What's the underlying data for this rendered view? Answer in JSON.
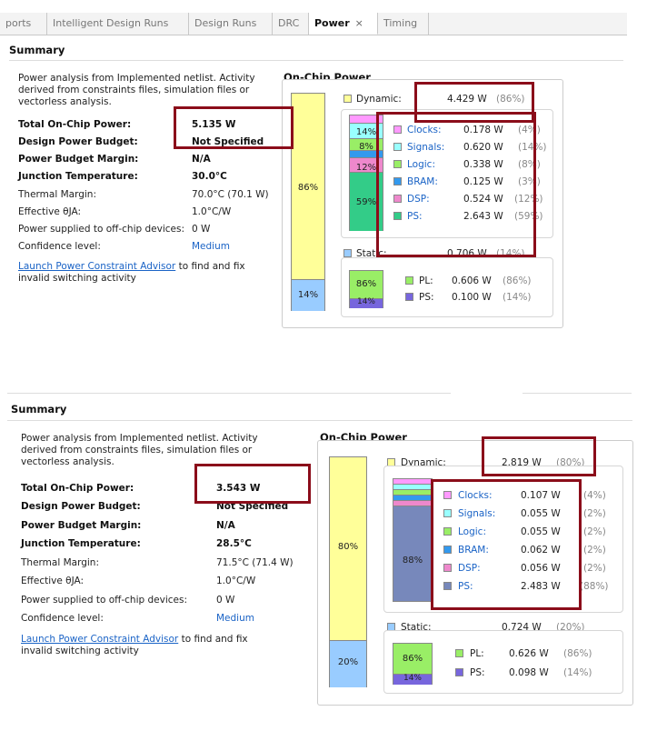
{
  "tabs": [
    "ports",
    "Intelligent Design Runs",
    "Design Runs",
    "DRC",
    "Power",
    "Timing"
  ],
  "tab_close_glyph": "×",
  "shared": {
    "summary_title": "Summary",
    "description": "Power analysis from Implemented netlist. Activity derived from constraints files, simulation files or vectorless analysis.",
    "on_chip_title": "On-Chip Power",
    "labels": {
      "total": "Total On-Chip Power:",
      "budget": "Design Power Budget:",
      "margin": "Power Budget Margin:",
      "junction": "Junction Temperature:",
      "thermal": "Thermal Margin:",
      "effective": "Effective θJA:",
      "offchip": "Power supplied to off-chip devices:",
      "confidence": "Confidence level:"
    },
    "link_text": "Launch Power Constraint Advisor",
    "link_suffix": " to find and fix",
    "link_suffix2": "invalid switching activity",
    "dynamic_label": "Dynamic:",
    "static_label": "Static:",
    "rows": [
      "Clocks:",
      "Signals:",
      "Logic:",
      "BRAM:",
      "DSP:",
      "PS:"
    ],
    "static_rows": [
      "PL:",
      "PS:"
    ]
  },
  "colors": {
    "yellow": "#ffff99",
    "lightblue": "#99ccff",
    "clocks": "#ff99ff",
    "signals": "#99ffff",
    "logic": "#99ee66",
    "bram": "#3399ee",
    "dsp": "#ee88cc",
    "ps_top": "#33cc88",
    "ps_bottom": "#7788bb",
    "pl": "#99ee66",
    "ps_static": "#7766dd",
    "accent": "#8b0d1a"
  },
  "top": {
    "values": {
      "total": "5.135 W",
      "budget": "Not Specified",
      "margin": "N/A",
      "junction": "30.0°C",
      "thermal": "70.0°C (70.1 W)",
      "effective": "1.0°C/W",
      "offchip": "0 W",
      "confidence": "Medium"
    },
    "bar": {
      "dynamic_pct": "86%",
      "static_pct": "14%"
    },
    "dynamic": {
      "value": "4.429 W",
      "pct": "(86%)"
    },
    "rows": [
      {
        "value": "0.178 W",
        "pct": "(4%)"
      },
      {
        "value": "0.620 W",
        "pct": "(14%)"
      },
      {
        "value": "0.338 W",
        "pct": "(8%)"
      },
      {
        "value": "0.125 W",
        "pct": "(3%)"
      },
      {
        "value": "0.524 W",
        "pct": "(12%)"
      },
      {
        "value": "2.643 W",
        "pct": "(59%)"
      }
    ],
    "dyn_bar_labels": [
      "14%",
      "8%",
      "12%",
      "59%"
    ],
    "static": {
      "value": "0.706 W",
      "pct": "(14%)"
    },
    "static_rows": [
      {
        "value": "0.606 W",
        "pct": "(86%)"
      },
      {
        "value": "0.100 W",
        "pct": "(14%)"
      }
    ],
    "static_bar_labels": [
      "86%",
      "14%"
    ]
  },
  "bottom": {
    "values": {
      "total": "3.543 W",
      "budget": "Not Specified",
      "margin": "N/A",
      "junction": "28.5°C",
      "thermal": "71.5°C (71.4 W)",
      "effective": "1.0°C/W",
      "offchip": "0 W",
      "confidence": "Medium"
    },
    "bar": {
      "dynamic_pct": "80%",
      "static_pct": "20%"
    },
    "dynamic": {
      "value": "2.819 W",
      "pct": "(80%)"
    },
    "rows": [
      {
        "value": "0.107 W",
        "pct": "(4%)"
      },
      {
        "value": "0.055 W",
        "pct": "(2%)"
      },
      {
        "value": "0.055 W",
        "pct": "(2%)"
      },
      {
        "value": "0.062 W",
        "pct": "(2%)"
      },
      {
        "value": "0.056 W",
        "pct": "(2%)"
      },
      {
        "value": "2.483 W",
        "pct": "(88%)"
      }
    ],
    "dyn_bar_labels": [
      "88%"
    ],
    "static": {
      "value": "0.724 W",
      "pct": "(20%)"
    },
    "static_rows": [
      {
        "value": "0.626 W",
        "pct": "(86%)"
      },
      {
        "value": "0.098 W",
        "pct": "(14%)"
      }
    ],
    "static_bar_labels": [
      "86%",
      "14%"
    ]
  }
}
